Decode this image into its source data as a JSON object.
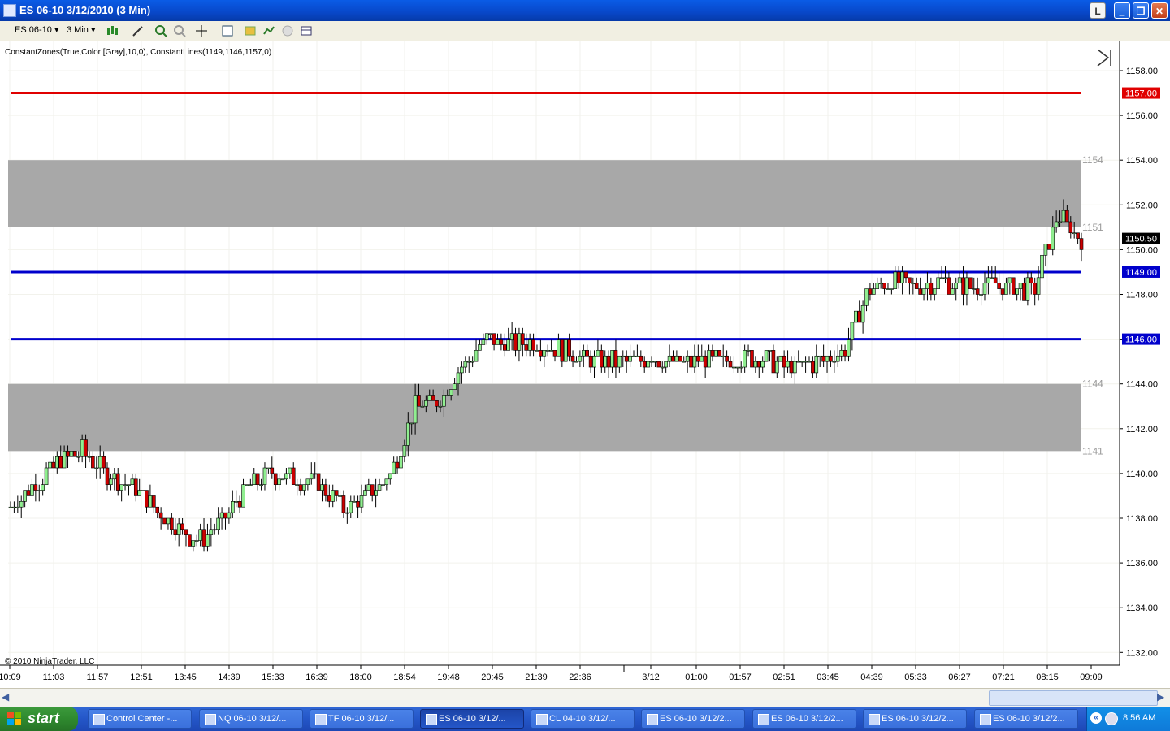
{
  "window": {
    "title": "ES 06-10  3/12/2010 (3 Min)"
  },
  "toolbar": {
    "instrument": "ES 06-10",
    "interval": "3 Min"
  },
  "chart": {
    "indicator_label": "ConstantZones(True,Color [Gray],10,0), ConstantLines(1149,1146,1157,0)",
    "copyright": "© 2010 NinjaTrader, LLC",
    "price_ticks": [
      "1158.00",
      "1156.00",
      "1154.00",
      "1152.00",
      "1150.00",
      "1148.00",
      "1146.00",
      "1144.00",
      "1142.00",
      "1140.00",
      "1138.00",
      "1136.00",
      "1134.00",
      "1132.00"
    ],
    "time_ticks": [
      "10:09",
      "11:03",
      "11:57",
      "12:51",
      "13:45",
      "14:39",
      "15:33",
      "16:39",
      "18:00",
      "18:54",
      "19:48",
      "20:45",
      "21:39",
      "22:36",
      "3/12",
      "01:00",
      "01:57",
      "02:51",
      "03:45",
      "04:39",
      "05:33",
      "06:27",
      "07:21",
      "08:15",
      "09:09"
    ],
    "zone_labels": [
      "1154",
      "1151",
      "1144",
      "1141"
    ],
    "price_markers": {
      "red_line": "1157.00",
      "last_price": "1150.50",
      "blue_line_1": "1149.00",
      "blue_line_2": "1146.00"
    },
    "colors": {
      "red_line": "#e00000",
      "blue_line": "#0000cc",
      "zone": "#a8a8a8",
      "up_bar": "#90ee90",
      "down_bar": "#cc0000"
    }
  },
  "chart_data": {
    "type": "candlestick",
    "constant_lines": [
      1157,
      1149,
      1146
    ],
    "constant_zones": [
      [
        1151,
        1154
      ],
      [
        1141,
        1144
      ]
    ],
    "ylim": [
      1131.5,
      1159.3
    ],
    "approx_close_path": [
      1138.5,
      1139.5,
      1140.5,
      1141,
      1140,
      1139.5,
      1138.5,
      1137.5,
      1137,
      1138,
      1139.5,
      1140,
      1139.8,
      1139.5,
      1138.5,
      1139,
      1140,
      1143,
      1143.2,
      1144.8,
      1146,
      1145.8,
      1145.8,
      1145.6,
      1145.2,
      1145.0,
      1145.0,
      1145.2,
      1145.0,
      1145.0,
      1145.0,
      1145.2,
      1145.0,
      1144.7,
      1145.0,
      1145.4,
      1148,
      1148.6,
      1148.4,
      1148.6,
      1148.3,
      1148.5,
      1148.3,
      1148.2,
      1151.5,
      1150.5
    ]
  },
  "taskbar": {
    "start_label": "start",
    "tasks": [
      "Control Center -...",
      "NQ 06-10  3/12/...",
      "TF 06-10  3/12/...",
      "ES 06-10  3/12/...",
      "CL 04-10  3/12/...",
      "ES 06-10  3/12/2...",
      "ES 06-10  3/12/2...",
      "ES 06-10  3/12/2...",
      "ES 06-10  3/12/2..."
    ],
    "clock": "8:56 AM"
  }
}
